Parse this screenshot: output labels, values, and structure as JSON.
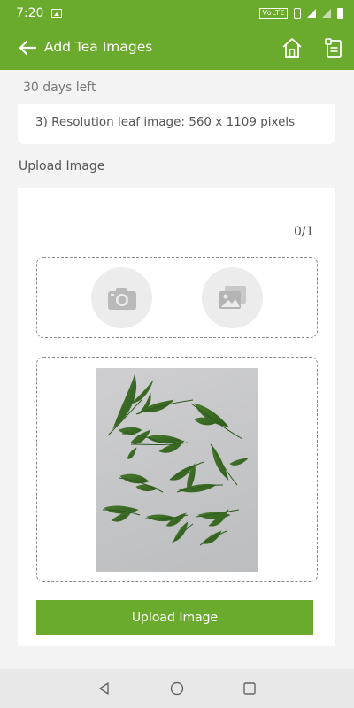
{
  "status_bar": {
    "time": "7:20",
    "volte_label": "VoLTE",
    "icons": [
      "gallery-icon",
      "volte-icon",
      "vibrate-icon",
      "signal-icon",
      "signal-icon",
      "battery-icon"
    ]
  },
  "app_bar": {
    "title": "Add Tea Images",
    "back_icon": "arrow-left-icon",
    "home_icon": "home-icon",
    "doc_icon": "document-icon",
    "background": "#6aab2d"
  },
  "days_left": "30 days left",
  "info": {
    "text": "3) Resolution leaf image: 560 x 1109 pixels"
  },
  "upload_section": {
    "label": "Upload Image",
    "counter": "0/1",
    "camera_icon": "camera-icon",
    "gallery_icon": "image-gallery-icon",
    "preview_image": "tea-leaves-image",
    "button_label": "Upload Image",
    "button_color": "#6aab2d"
  },
  "nav_bar": {
    "icons": [
      "back-triangle-icon",
      "home-circle-icon",
      "recents-square-icon"
    ]
  }
}
